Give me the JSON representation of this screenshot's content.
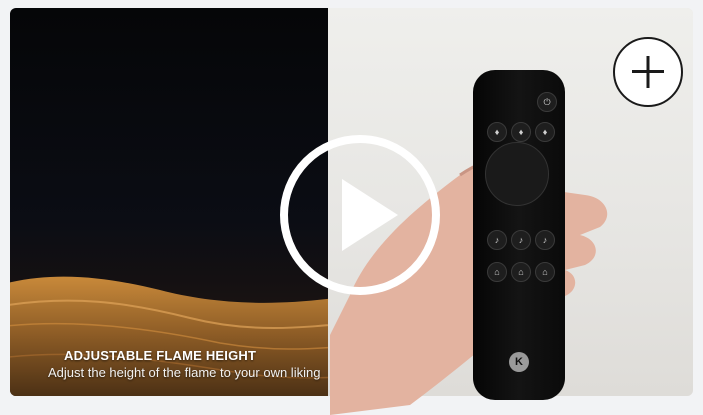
{
  "video": {
    "caption_title": "ADJUSTABLE FLAME HEIGHT",
    "caption_subtitle": "Adjust the height of the flame to your own liking",
    "remote_brand_letter": "K",
    "controls": {
      "play_icon": "play-icon",
      "add_icon": "plus-icon"
    }
  },
  "colors": {
    "overlay_white": "#ffffff",
    "dark_panel": "#0b0d14"
  }
}
